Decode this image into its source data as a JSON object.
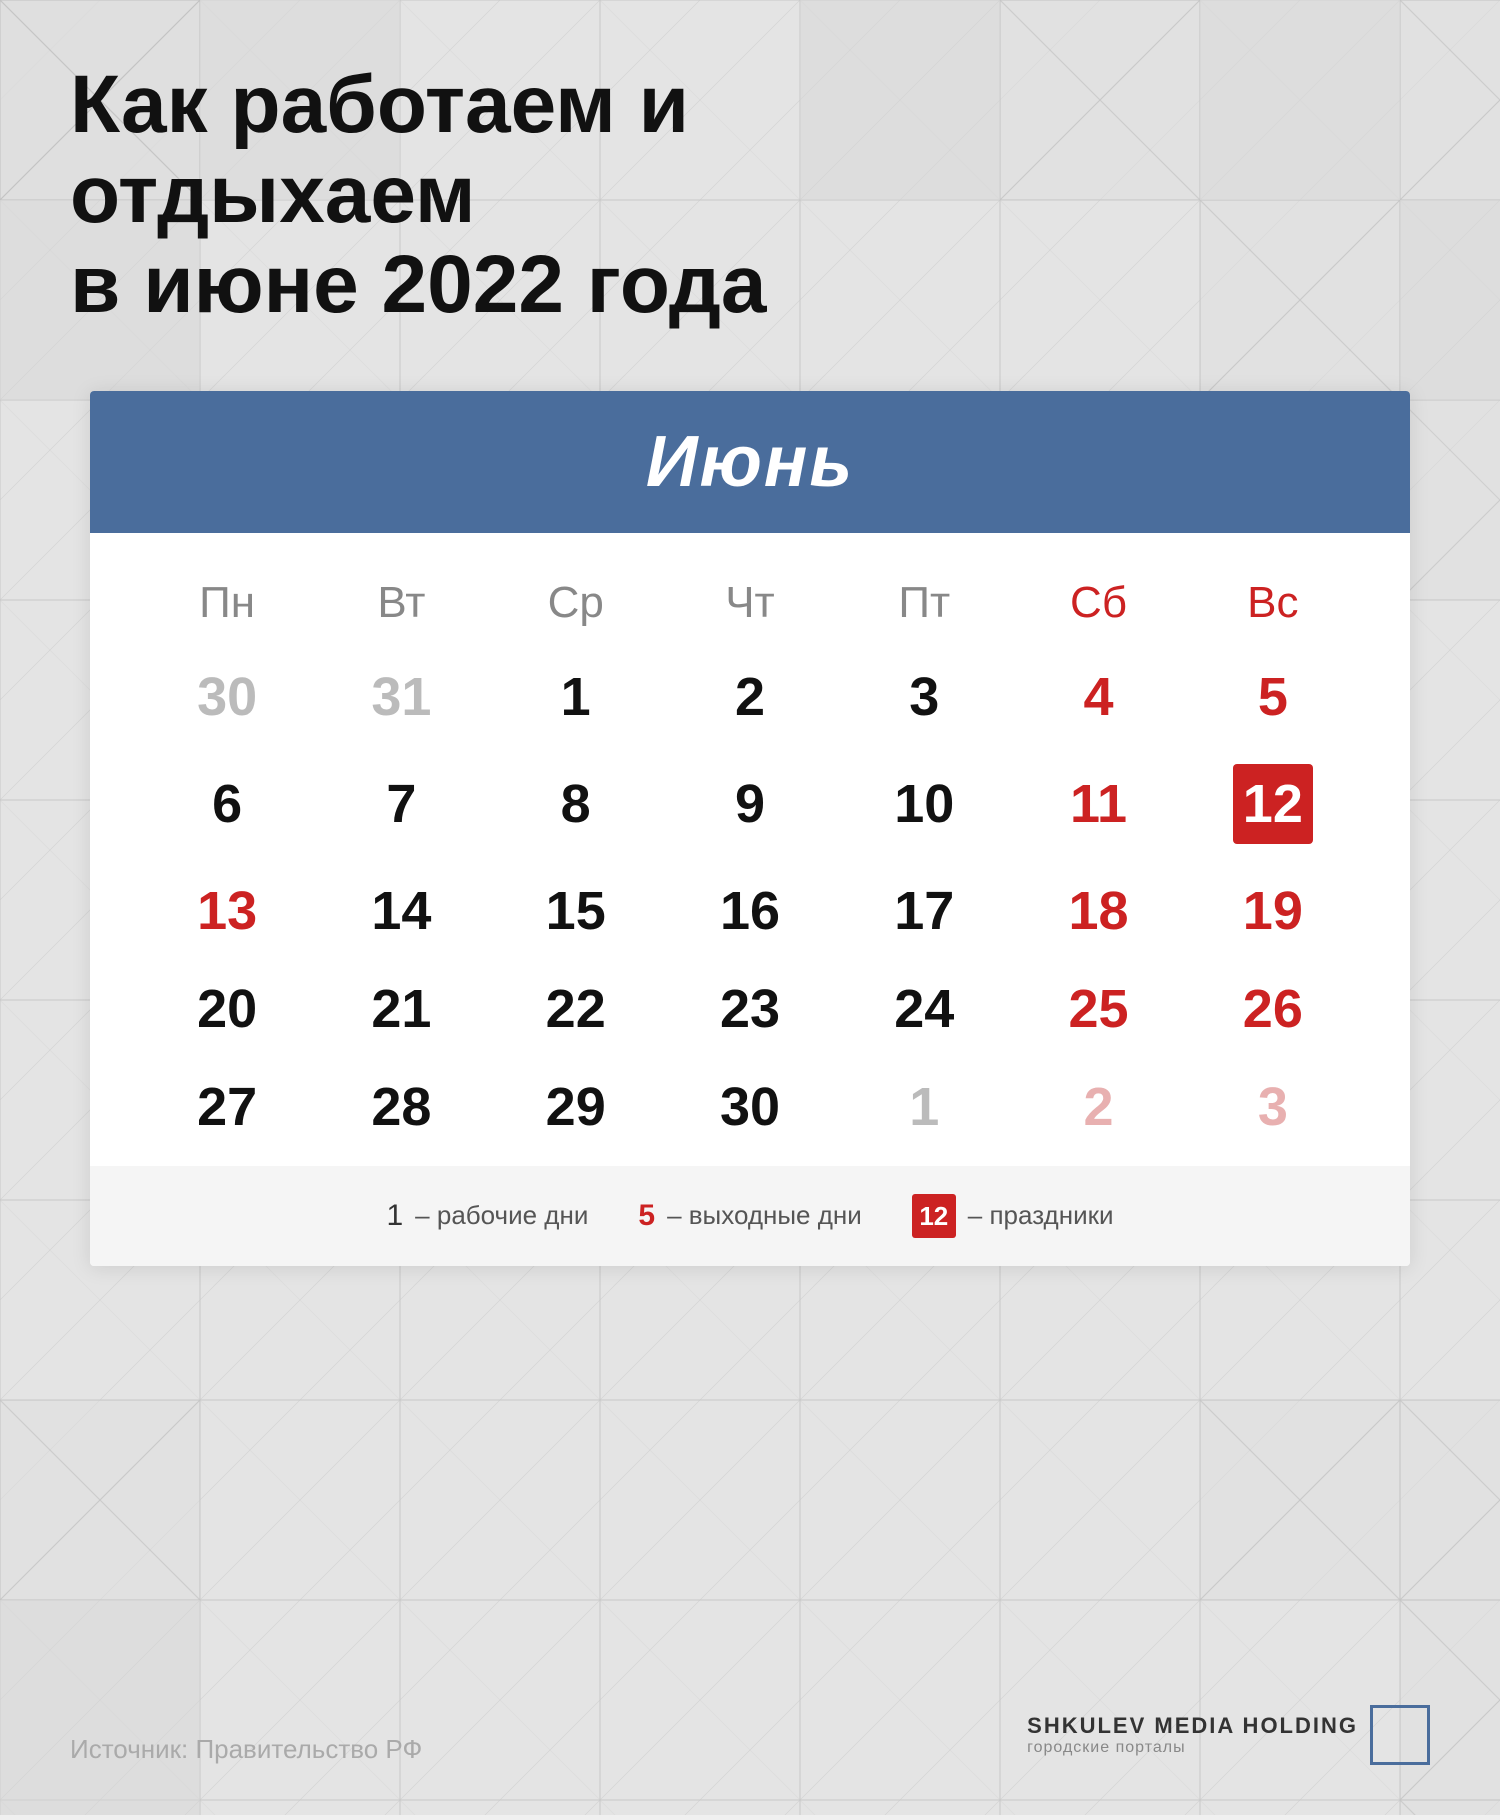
{
  "page": {
    "title_line1": "Как работаем и отдыхаем",
    "title_line2": "в июне 2022 года",
    "background_color": "#e8e8e8",
    "accent_color": "#4a6d9c"
  },
  "calendar": {
    "month_name": "Июнь",
    "header_color": "#4a6d9c",
    "weekdays": [
      "Пн",
      "Вт",
      "Ср",
      "Чт",
      "Пт",
      "Сб",
      "Вс"
    ],
    "weekend_cols": [
      5,
      6
    ],
    "rows": [
      [
        {
          "day": "30",
          "type": "prev-month"
        },
        {
          "day": "31",
          "type": "prev-month"
        },
        {
          "day": "1",
          "type": "normal"
        },
        {
          "day": "2",
          "type": "normal"
        },
        {
          "day": "3",
          "type": "normal"
        },
        {
          "day": "4",
          "type": "weekend-day"
        },
        {
          "day": "5",
          "type": "weekend-day"
        }
      ],
      [
        {
          "day": "6",
          "type": "normal"
        },
        {
          "day": "7",
          "type": "normal"
        },
        {
          "day": "8",
          "type": "normal"
        },
        {
          "day": "9",
          "type": "normal"
        },
        {
          "day": "10",
          "type": "normal"
        },
        {
          "day": "11",
          "type": "weekend-day"
        },
        {
          "day": "12",
          "type": "holiday"
        }
      ],
      [
        {
          "day": "13",
          "type": "weekend-day"
        },
        {
          "day": "14",
          "type": "normal"
        },
        {
          "day": "15",
          "type": "normal"
        },
        {
          "day": "16",
          "type": "normal"
        },
        {
          "day": "17",
          "type": "normal"
        },
        {
          "day": "18",
          "type": "weekend-day"
        },
        {
          "day": "19",
          "type": "weekend-day"
        }
      ],
      [
        {
          "day": "20",
          "type": "normal"
        },
        {
          "day": "21",
          "type": "normal"
        },
        {
          "day": "22",
          "type": "normal"
        },
        {
          "day": "23",
          "type": "normal"
        },
        {
          "day": "24",
          "type": "normal"
        },
        {
          "day": "25",
          "type": "weekend-day"
        },
        {
          "day": "26",
          "type": "weekend-day"
        }
      ],
      [
        {
          "day": "27",
          "type": "normal"
        },
        {
          "day": "28",
          "type": "normal"
        },
        {
          "day": "29",
          "type": "normal"
        },
        {
          "day": "30",
          "type": "normal"
        },
        {
          "day": "1",
          "type": "next-month"
        },
        {
          "day": "2",
          "type": "next-month"
        },
        {
          "day": "3",
          "type": "next-month"
        }
      ]
    ],
    "legend": {
      "workday_num": "1",
      "workday_label": "– рабочие дни",
      "weekend_num": "5",
      "weekend_label": "– выходные дни",
      "holiday_num": "12",
      "holiday_label": "– праздники"
    }
  },
  "footer": {
    "source_label": "Источник: Правительство РФ",
    "brand_name_line1": "SHKULEV MEDIA HOLDING",
    "brand_name_line2": "городские порталы"
  }
}
